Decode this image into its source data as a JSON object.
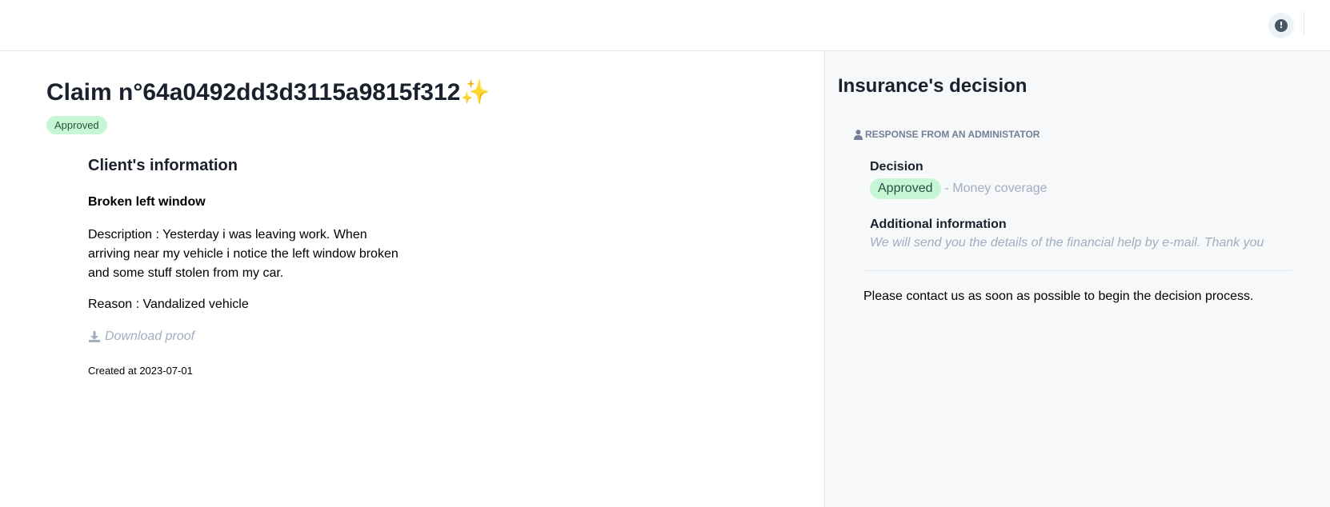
{
  "header": {
    "info_icon_glyph": "!"
  },
  "claim": {
    "title": "Claim n°64a0492dd3d3115a9815f312✨",
    "status": "Approved",
    "client_section_title": "Client's information",
    "name": "Broken left window",
    "description": "Description : Yesterday i was leaving work. When arriving near my vehicle i notice the left window broken and some stuff stolen from my car.",
    "reason": "Reason : Vandalized vehicle",
    "download_label": "Download proof",
    "created_at": "Created at 2023-07-01"
  },
  "decision": {
    "title": "Insurance's decision",
    "admin_label": "RESPONSE FROM AN ADMINISTATOR",
    "decision_label": "Decision",
    "status": "Approved",
    "coverage": "- Money coverage",
    "additional_label": "Additional information",
    "additional_text": "We will send you the details of the financial help by e-mail. Thank you",
    "contact_text": "Please contact us as soon as possible to begin the decision process."
  },
  "colors": {
    "approved_bg": "#c6f6d5",
    "approved_text": "#22543d",
    "muted": "#a0aec0",
    "panel_bg": "#f7f8fa"
  },
  "icons": {
    "info": "alert-circle-icon",
    "download": "download-icon",
    "admin": "user-icon"
  }
}
